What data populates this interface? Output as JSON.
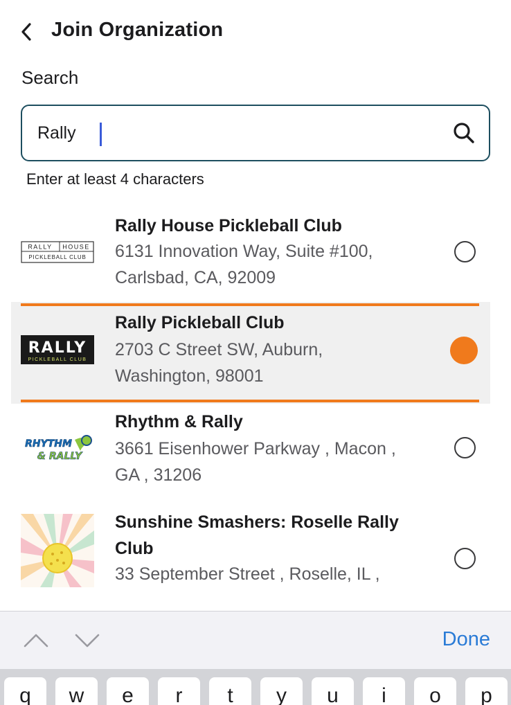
{
  "header": {
    "title": "Join Organization",
    "back_icon": "chevron-left-icon"
  },
  "search": {
    "label": "Search",
    "value": "Rally",
    "helper": "Enter at least 4 characters",
    "icon": "search-icon"
  },
  "results": [
    {
      "name": "Rally House Pickleball Club",
      "address_line1": "6131 Innovation Way, Suite #100,",
      "address_line2": "Carlsbad, CA, 92009",
      "logo_text_top_left": "RALLY",
      "logo_text_top_right": "HOUSE",
      "logo_text_bottom": "PICKLEBALL CLUB",
      "selected": false
    },
    {
      "name": "Rally Pickleball Club",
      "address_line1": "2703 C Street SW, Auburn,",
      "address_line2": "Washington, 98001",
      "logo_text_top": "RALLY",
      "logo_text_bottom": "PICKLEBALL CLUB",
      "selected": true
    },
    {
      "name": "Rhythm & Rally",
      "address_line1": "3661 Eisenhower Parkway , Macon ,",
      "address_line2": "GA , 31206",
      "logo_text_top": "RHYTHM",
      "logo_text_bottom": "& RALLY",
      "selected": false
    },
    {
      "name_line1": "Sunshine Smashers: Roselle Rally",
      "name_line2": "Club",
      "address_line1": "33 September Street , Roselle, IL ,",
      "selected": false
    }
  ],
  "colors": {
    "accent": "#f07a1c",
    "border": "#1d4e5f",
    "link": "#2a7bd6"
  },
  "keyboard_toolbar": {
    "done_label": "Done",
    "prev_icon": "chevron-up-icon",
    "next_icon": "chevron-down-icon"
  },
  "keyboard_keys": [
    "q",
    "w",
    "e",
    "r",
    "t",
    "y",
    "u",
    "i",
    "o",
    "p"
  ]
}
